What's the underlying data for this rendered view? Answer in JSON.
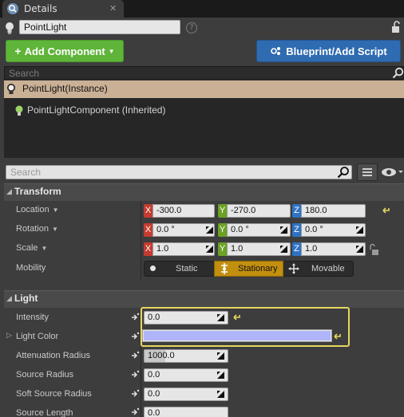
{
  "tab": {
    "title": "Details"
  },
  "actor": {
    "name": "PointLight"
  },
  "buttons": {
    "add_component": "Add Component",
    "blueprint": "Blueprint/Add Script"
  },
  "component_search": {
    "placeholder": "Search"
  },
  "component_tree": {
    "selected": "PointLight(Instance)",
    "items": [
      "PointLightComponent (Inherited)"
    ]
  },
  "details_search": {
    "placeholder": "Search"
  },
  "transform": {
    "title": "Transform",
    "location": {
      "label": "Location",
      "x": "-300.0",
      "y": "-270.0",
      "z": "180.0"
    },
    "rotation": {
      "label": "Rotation",
      "x": "0.0 °",
      "y": "0.0 °",
      "z": "0.0 °"
    },
    "scale": {
      "label": "Scale",
      "x": "1.0",
      "y": "1.0",
      "z": "1.0"
    },
    "mobility": {
      "label": "Mobility",
      "options": [
        "Static",
        "Stationary",
        "Movable"
      ],
      "selected": "Stationary"
    }
  },
  "axes": {
    "x": "X",
    "y": "Y",
    "z": "Z"
  },
  "light": {
    "title": "Light",
    "intensity": {
      "label": "Intensity",
      "value": "0.0"
    },
    "light_color": {
      "label": "Light Color",
      "color": "#b0b4fa"
    },
    "attenuation_radius": {
      "label": "Attenuation Radius",
      "value": "1000.0"
    },
    "source_radius": {
      "label": "Source Radius",
      "value": "0.0"
    },
    "soft_source_radius": {
      "label": "Soft Source Radius",
      "value": "0.0"
    },
    "source_length": {
      "label": "Source Length",
      "value": "0.0"
    }
  },
  "colors": {
    "add_button": "#5fb43a",
    "blueprint_button": "#2f6bb1",
    "selection": "#cab095",
    "mobility_selected": "#c28f0f",
    "highlight_outline": "#e6d65e"
  }
}
